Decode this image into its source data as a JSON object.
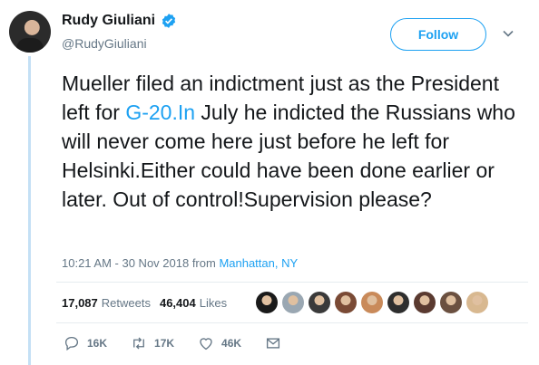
{
  "tweet": {
    "display_name": "Rudy Giuliani",
    "handle": "@RudyGiuliani",
    "follow_label": "Follow",
    "text_before_link": "Mueller filed an indictment just as the President left for ",
    "link_text": "G-20.In",
    "text_after_link": " July he indicted the Russians who will never come here just before he left for Helsinki.Either could have been done earlier or later. Out of control!Supervision please?",
    "timestamp": "10:21 AM - 30 Nov 2018 from ",
    "location": "Manhattan, NY"
  },
  "stats": {
    "retweets_count": "17,087",
    "retweets_label": "Retweets",
    "likes_count": "46,404",
    "likes_label": "Likes"
  },
  "actions": {
    "reply_count": "16K",
    "retweet_count": "17K",
    "like_count": "46K"
  },
  "colors": {
    "accent": "#1da1f2",
    "secondary_text": "#657786",
    "thread_line": "#c4e0f5"
  },
  "liker_avatars": [
    "#1a1a1a",
    "#9aa7b2",
    "#3a3a3a",
    "#7a4a35",
    "#c98a5a",
    "#2e2e2e",
    "#5a3a30",
    "#6b5040",
    "#d8b890"
  ]
}
